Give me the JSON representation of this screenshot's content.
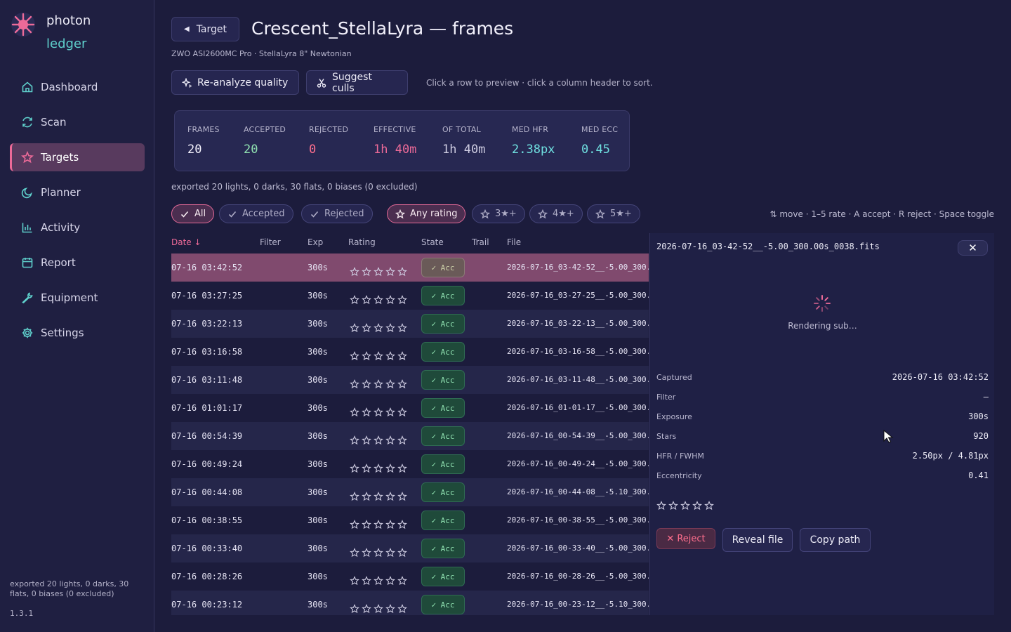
{
  "sidebar": {
    "brand_top": "photon",
    "brand_bottom": "ledger",
    "nav": [
      {
        "label": "Dashboard",
        "icon": "home-icon"
      },
      {
        "label": "Scan",
        "icon": "refresh-icon"
      },
      {
        "label": "Targets",
        "icon": "star-icon",
        "active": true
      },
      {
        "label": "Planner",
        "icon": "moon-icon"
      },
      {
        "label": "Activity",
        "icon": "bar-chart-icon"
      },
      {
        "label": "Report",
        "icon": "calendar-icon"
      },
      {
        "label": "Equipment",
        "icon": "wrench-icon"
      },
      {
        "label": "Settings",
        "icon": "gear-icon"
      }
    ],
    "footer_note": "exported 20 lights, 0 darks, 30 flats, 0 biases (0 excluded)",
    "version": "1.3.1"
  },
  "header": {
    "back_label": "Target",
    "title": "Crescent_StellaLyra — frames",
    "subtitle": "ZWO ASI2600MC Pro · StellaLyra 8\" Newtonian",
    "reanalyze_label": "Re-analyze quality",
    "suggest_label": "Suggest culls",
    "hint": "Click a row to preview · click a column header to sort."
  },
  "stats": {
    "frames": {
      "label": "FRAMES",
      "value": "20"
    },
    "accepted": {
      "label": "ACCEPTED",
      "value": "20"
    },
    "rejected": {
      "label": "REJECTED",
      "value": "0"
    },
    "effective": {
      "label": "EFFECTIVE",
      "value": "1h 40m"
    },
    "of_total": {
      "label": "OF TOTAL",
      "value": "1h 40m"
    },
    "med_hfr": {
      "label": "MED HFR",
      "value": "2.38px"
    },
    "med_ecc": {
      "label": "MED ECC",
      "value": "0.45"
    }
  },
  "export_line": "exported 20 lights, 0 darks, 30 flats, 0 biases (0 excluded)",
  "filters": {
    "all": "All",
    "accepted": "Accepted",
    "rejected": "Rejected",
    "any_rating": "Any rating",
    "r3": "3★+",
    "r4": "4★+",
    "r5": "5★+"
  },
  "shortcuts": "⇅ move · 1–5 rate · A accept · R reject · Space toggle",
  "table": {
    "headers": {
      "date": "Date ↓",
      "filter": "Filter",
      "exp": "Exp",
      "rating": "Rating",
      "state": "State",
      "trail": "Trail",
      "file": "File"
    },
    "rows": [
      {
        "date": "07-16 03:42:52",
        "exp": "300s",
        "state": "✓ Acc",
        "file": "2026-07-16_03-42-52__-5.00_300.",
        "selected": true
      },
      {
        "date": "07-16 03:27:25",
        "exp": "300s",
        "state": "✓ Acc",
        "file": "2026-07-16_03-27-25__-5.00_300."
      },
      {
        "date": "07-16 03:22:13",
        "exp": "300s",
        "state": "✓ Acc",
        "file": "2026-07-16_03-22-13__-5.00_300."
      },
      {
        "date": "07-16 03:16:58",
        "exp": "300s",
        "state": "✓ Acc",
        "file": "2026-07-16_03-16-58__-5.00_300."
      },
      {
        "date": "07-16 03:11:48",
        "exp": "300s",
        "state": "✓ Acc",
        "file": "2026-07-16_03-11-48__-5.00_300."
      },
      {
        "date": "07-16 01:01:17",
        "exp": "300s",
        "state": "✓ Acc",
        "file": "2026-07-16_01-01-17__-5.00_300."
      },
      {
        "date": "07-16 00:54:39",
        "exp": "300s",
        "state": "✓ Acc",
        "file": "2026-07-16_00-54-39__-5.00_300."
      },
      {
        "date": "07-16 00:49:24",
        "exp": "300s",
        "state": "✓ Acc",
        "file": "2026-07-16_00-49-24__-5.00_300."
      },
      {
        "date": "07-16 00:44:08",
        "exp": "300s",
        "state": "✓ Acc",
        "file": "2026-07-16_00-44-08__-5.10_300."
      },
      {
        "date": "07-16 00:38:55",
        "exp": "300s",
        "state": "✓ Acc",
        "file": "2026-07-16_00-38-55__-5.00_300."
      },
      {
        "date": "07-16 00:33:40",
        "exp": "300s",
        "state": "✓ Acc",
        "file": "2026-07-16_00-33-40__-5.00_300."
      },
      {
        "date": "07-16 00:28:26",
        "exp": "300s",
        "state": "✓ Acc",
        "file": "2026-07-16_00-28-26__-5.00_300."
      },
      {
        "date": "07-16 00:23:12",
        "exp": "300s",
        "state": "✓ Acc",
        "file": "2026-07-16_00-23-12__-5.10_300."
      }
    ]
  },
  "preview": {
    "filename": "2026-07-16_03-42-52__-5.00_300.00s_0038.fits",
    "close": "✕",
    "rendering": "Rendering sub…",
    "meta": [
      {
        "k": "Captured",
        "v": "2026-07-16 03:42:52"
      },
      {
        "k": "Filter",
        "v": "—"
      },
      {
        "k": "Exposure",
        "v": "300s"
      },
      {
        "k": "Stars",
        "v": "920"
      },
      {
        "k": "HFR / FWHM",
        "v": "2.50px / 4.81px"
      },
      {
        "k": "Eccentricity",
        "v": "0.41"
      }
    ],
    "reject": "✕ Reject",
    "reveal": "Reveal file",
    "copy": "Copy path"
  },
  "colors": {
    "bg": "#1c1c3c",
    "accent_pink": "#ec6a98",
    "accent_teal": "#5fd0cc",
    "accept_green": "#8fe0b0",
    "hfr_teal": "#6fe0e0",
    "rejected_red": "#ff6f8e"
  }
}
